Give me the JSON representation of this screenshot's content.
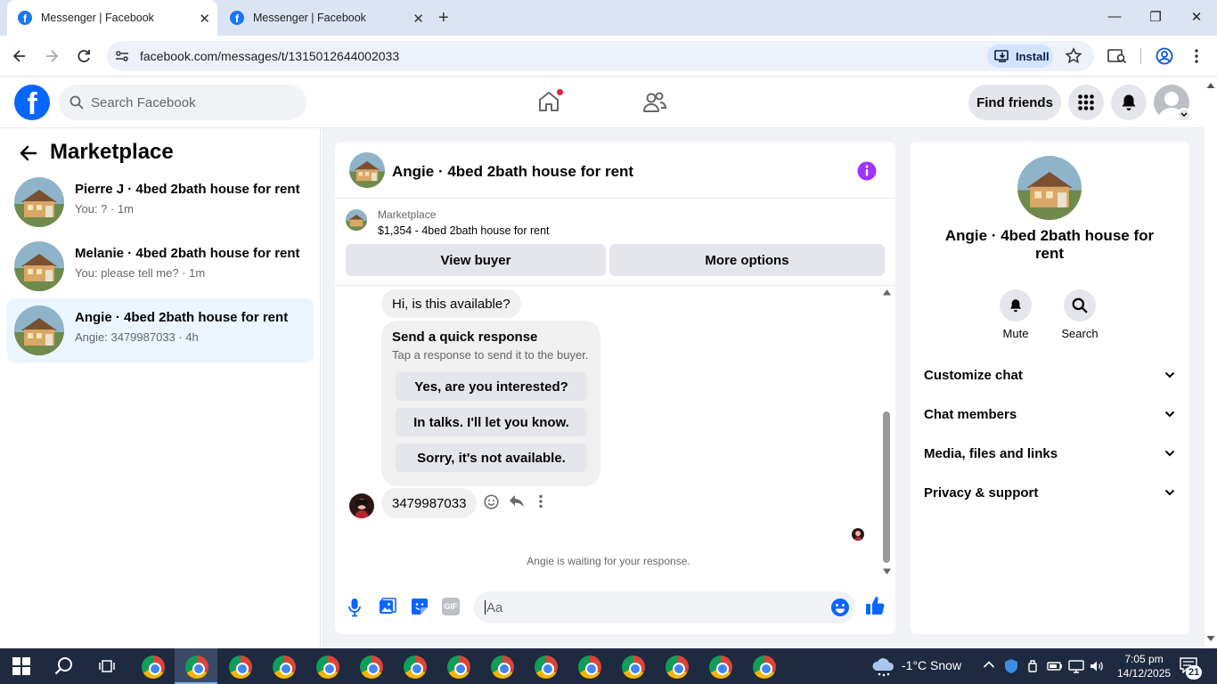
{
  "browser": {
    "tabs": [
      {
        "title": "Messenger | Facebook"
      },
      {
        "title": "Messenger | Facebook"
      }
    ],
    "url": "facebook.com/messages/t/1315012644002033",
    "install_label": "Install"
  },
  "header": {
    "search_placeholder": "Search Facebook",
    "find_friends_label": "Find friends"
  },
  "sidebar": {
    "title": "Marketplace",
    "conversations": [
      {
        "name": "Pierre J · 4bed 2bath house for rent",
        "preview": "You: ? · 1m"
      },
      {
        "name": "Melanie · 4bed 2bath house for rent",
        "preview": "You: please tell me? · 1m"
      },
      {
        "name": "Angie · 4bed 2bath house for rent",
        "preview": "Angie: 3479987033 · 4h"
      }
    ]
  },
  "chat": {
    "title": "Angie · 4bed 2bath house for rent",
    "listing_label": "Marketplace",
    "listing_price": "$1,354 - 4bed 2bath house for rent",
    "view_buyer_label": "View buyer",
    "more_options_label": "More options",
    "messages": {
      "first": "Hi, is this available?",
      "quick_title": "Send a quick response",
      "quick_subtitle": "Tap a response to send it to the buyer.",
      "quick_options": [
        "Yes, are you interested?",
        "In talks. I'll let you know.",
        "Sorry, it's not available."
      ],
      "phone_message": "3479987033"
    },
    "waiting_text": "Angie is waiting for your response.",
    "composer_placeholder": "Aa",
    "gif_label": "GIF"
  },
  "details": {
    "title": "Angie · 4bed 2bath house for rent",
    "mute_label": "Mute",
    "search_label": "Search",
    "sections": [
      "Customize chat",
      "Chat members",
      "Media, files and links",
      "Privacy & support"
    ]
  },
  "taskbar": {
    "weather": "-1°C  Snow",
    "time": "7:05 pm",
    "date": "14/12/2025",
    "notification_count": "21"
  },
  "colors": {
    "fb_blue": "#0866ff",
    "messenger_purple": "#a033ff",
    "active_conv": "#ebf5ff"
  }
}
